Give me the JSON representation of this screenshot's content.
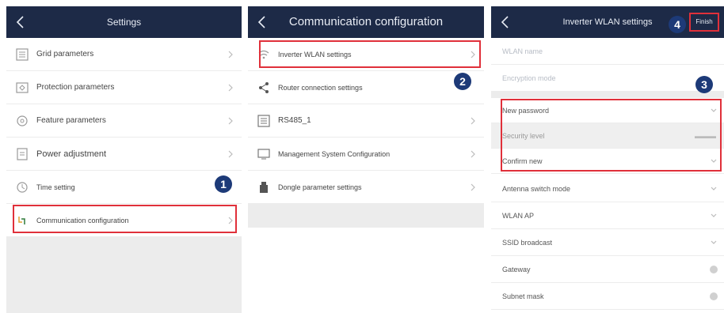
{
  "panels": {
    "settings": {
      "title": "Settings",
      "items": [
        {
          "label": "Grid parameters"
        },
        {
          "label": "Protection parameters"
        },
        {
          "label": "Feature parameters"
        },
        {
          "label": "Power adjustment"
        },
        {
          "label": "Time setting"
        },
        {
          "label": "Communication configuration"
        }
      ],
      "badge": "1"
    },
    "communication": {
      "title": "Communication configuration",
      "items": [
        {
          "label": "Inverter WLAN settings"
        },
        {
          "label": "Router connection settings"
        },
        {
          "label": "RS485_1"
        },
        {
          "label": "Management System Configuration"
        },
        {
          "label": "Dongle parameter settings"
        }
      ],
      "badge": "2"
    },
    "wlan": {
      "title": "Inverter WLAN settings",
      "finish_label": "Finish",
      "rows": [
        {
          "label": "WLAN name"
        },
        {
          "label": "Encryption mode"
        },
        {
          "label": "New password"
        },
        {
          "label": "Security level"
        },
        {
          "label": "Confirm new"
        },
        {
          "label": "Antenna switch mode"
        },
        {
          "label": "WLAN AP"
        },
        {
          "label": "SSID broadcast"
        },
        {
          "label": "Gateway"
        },
        {
          "label": "Subnet mask"
        }
      ],
      "badge_rows": "3",
      "badge_finish": "4"
    }
  },
  "colors": {
    "topbar": "#1d2a47",
    "highlight": "#e0303a",
    "badge": "#1d3a78"
  }
}
